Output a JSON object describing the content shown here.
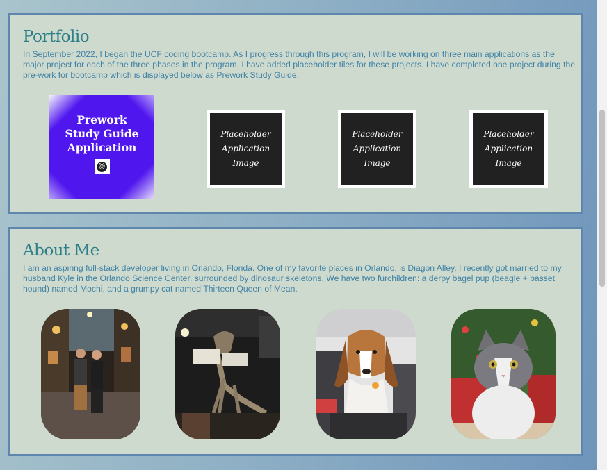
{
  "portfolio": {
    "title": "Portfolio",
    "description": "In September 2022, I began the UCF coding bootcamp. As I progress through this program, I will be working on three main applications as the major project for each of the three phases in the program. I have added placeholder tiles for these projects. I have completed one project during the pre-work for bootcamp which is displayed below as Prework Study Guide.",
    "tiles": [
      {
        "label": "Prework Study Guide Application",
        "icon": "cat-logo-icon"
      },
      {
        "label": "Placeholder Application Image"
      },
      {
        "label": "Placeholder Application Image"
      },
      {
        "label": "Placeholder Application Image"
      }
    ]
  },
  "about": {
    "title": "About Me",
    "description": "I am an aspiring full-stack developer living in Orlando, Florida. One of my favorite places in Orlando, is Diagon Alley. I recently got married to my husband Kyle in the Orlando Science Center, surrounded by dinosaur skeletons. We have two furchildren: a derpy bagel pup (beagle + basset hound) named Mochi, and a grumpy cat named Thirteen Queen of Mean.",
    "photos": [
      {
        "subject": "couple-at-diagon-alley-photo"
      },
      {
        "subject": "dinosaur-skeleton-photo"
      },
      {
        "subject": "beagle-basset-dog-photo"
      },
      {
        "subject": "gray-cat-photo"
      }
    ]
  },
  "colors": {
    "section_background": "#cfdacf",
    "section_border": "#5f86ad",
    "title_color": "#2c7f86",
    "text_color": "#3f82a4",
    "prework_tile": "#4f16ee",
    "placeholder_tile": "#212121"
  }
}
